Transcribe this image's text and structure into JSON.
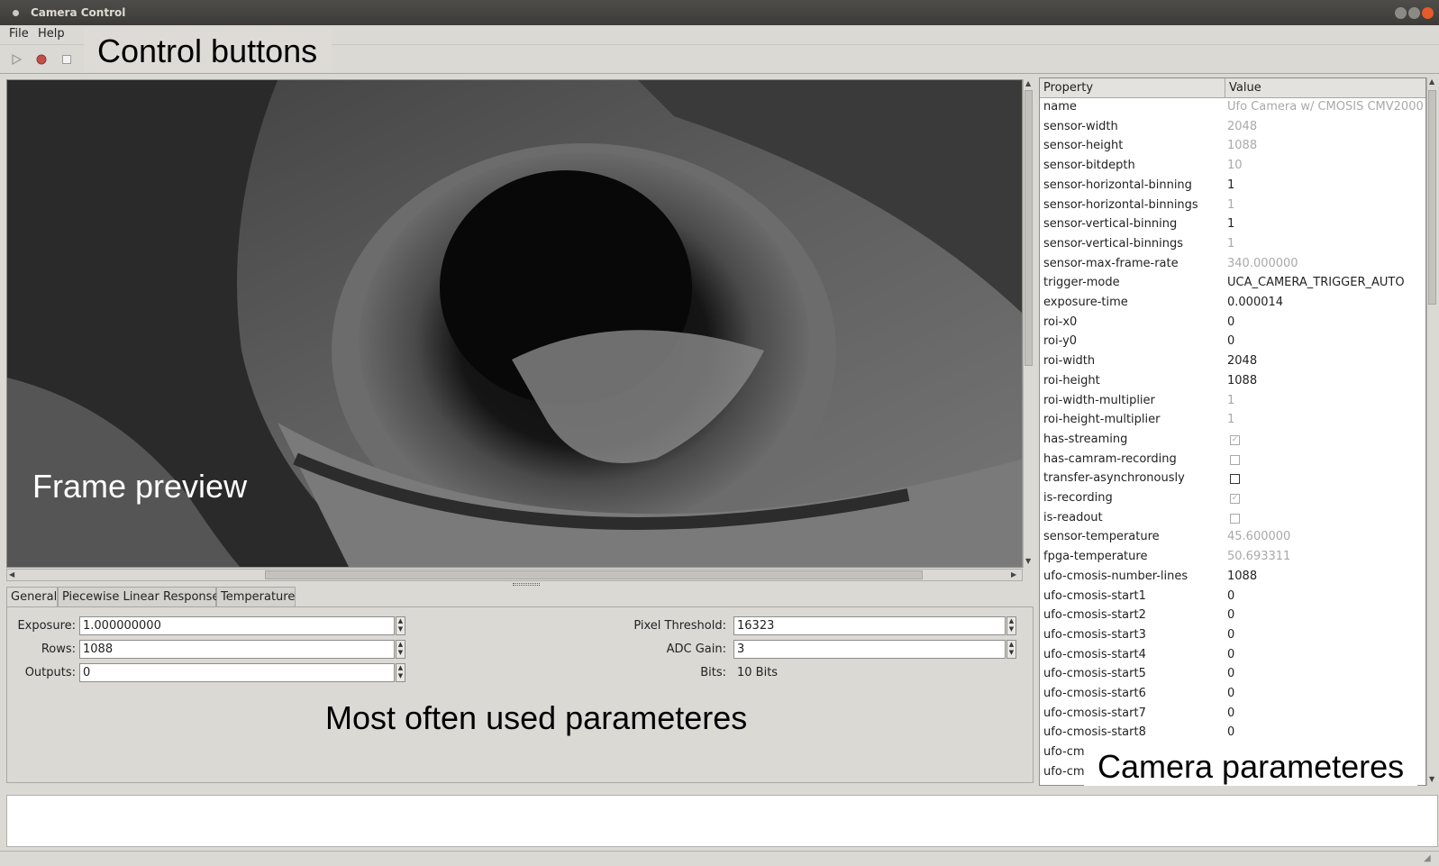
{
  "window": {
    "title": "Camera Control"
  },
  "menu": {
    "file": "File",
    "help": "Help"
  },
  "toolbar": {
    "icons": [
      "play-icon",
      "record-icon",
      "stop-icon"
    ]
  },
  "annotations": {
    "control_buttons": "Control buttons",
    "frame_preview": "Frame preview",
    "most_used": "Most often used parameteres",
    "camera_params": "Camera parameteres"
  },
  "tabs": [
    "General",
    "Piecewise Linear Response",
    "Temperature"
  ],
  "general": {
    "exposure": {
      "label": "Exposure:",
      "value": "1.000000000"
    },
    "rows": {
      "label": "Rows:",
      "value": "1088"
    },
    "outputs": {
      "label": "Outputs:",
      "value": "0"
    },
    "pixel_threshold": {
      "label": "Pixel Threshold:",
      "value": "16323"
    },
    "adc_gain": {
      "label": "ADC Gain:",
      "value": "3"
    },
    "bits": {
      "label": "Bits:",
      "value": "10 Bits"
    }
  },
  "properties": {
    "header": {
      "property": "Property",
      "value": "Value"
    },
    "rows": [
      {
        "k": "name",
        "v": "Ufo Camera w/ CMOSIS CMV2000",
        "ro": true
      },
      {
        "k": "sensor-width",
        "v": "2048",
        "ro": true
      },
      {
        "k": "sensor-height",
        "v": "1088",
        "ro": true
      },
      {
        "k": "sensor-bitdepth",
        "v": "10",
        "ro": true
      },
      {
        "k": "sensor-horizontal-binning",
        "v": "1",
        "ro": false
      },
      {
        "k": "sensor-horizontal-binnings",
        "v": "1",
        "ro": true
      },
      {
        "k": "sensor-vertical-binning",
        "v": "1",
        "ro": false
      },
      {
        "k": "sensor-vertical-binnings",
        "v": "1",
        "ro": true
      },
      {
        "k": "sensor-max-frame-rate",
        "v": "340.000000",
        "ro": true
      },
      {
        "k": "trigger-mode",
        "v": "UCA_CAMERA_TRIGGER_AUTO",
        "ro": false
      },
      {
        "k": "exposure-time",
        "v": "0.000014",
        "ro": false
      },
      {
        "k": "roi-x0",
        "v": "0",
        "ro": false
      },
      {
        "k": "roi-y0",
        "v": "0",
        "ro": false
      },
      {
        "k": "roi-width",
        "v": "2048",
        "ro": false
      },
      {
        "k": "roi-height",
        "v": "1088",
        "ro": false
      },
      {
        "k": "roi-width-multiplier",
        "v": "1",
        "ro": true
      },
      {
        "k": "roi-height-multiplier",
        "v": "1",
        "ro": true
      },
      {
        "k": "has-streaming",
        "cb": true,
        "checked": true,
        "ro": true
      },
      {
        "k": "has-camram-recording",
        "cb": true,
        "checked": false,
        "ro": true
      },
      {
        "k": "transfer-asynchronously",
        "cb": true,
        "checked": false,
        "ro": false
      },
      {
        "k": "is-recording",
        "cb": true,
        "checked": true,
        "ro": true
      },
      {
        "k": "is-readout",
        "cb": true,
        "checked": false,
        "ro": true
      },
      {
        "k": "sensor-temperature",
        "v": "45.600000",
        "ro": true
      },
      {
        "k": "fpga-temperature",
        "v": "50.693311",
        "ro": true
      },
      {
        "k": "ufo-cmosis-number-lines",
        "v": "1088",
        "ro": false
      },
      {
        "k": "ufo-cmosis-start1",
        "v": "0",
        "ro": false
      },
      {
        "k": "ufo-cmosis-start2",
        "v": "0",
        "ro": false
      },
      {
        "k": "ufo-cmosis-start3",
        "v": "0",
        "ro": false
      },
      {
        "k": "ufo-cmosis-start4",
        "v": "0",
        "ro": false
      },
      {
        "k": "ufo-cmosis-start5",
        "v": "0",
        "ro": false
      },
      {
        "k": "ufo-cmosis-start6",
        "v": "0",
        "ro": false
      },
      {
        "k": "ufo-cmosis-start7",
        "v": "0",
        "ro": false
      },
      {
        "k": "ufo-cmosis-start8",
        "v": "0",
        "ro": false
      },
      {
        "k": "ufo-cm",
        "v": "",
        "ro": false
      },
      {
        "k": "ufo-cm",
        "v": "",
        "ro": false
      }
    ]
  },
  "colors": {
    "readonly_text": "#a9a9a9",
    "accent_close": "#e45a2a"
  }
}
